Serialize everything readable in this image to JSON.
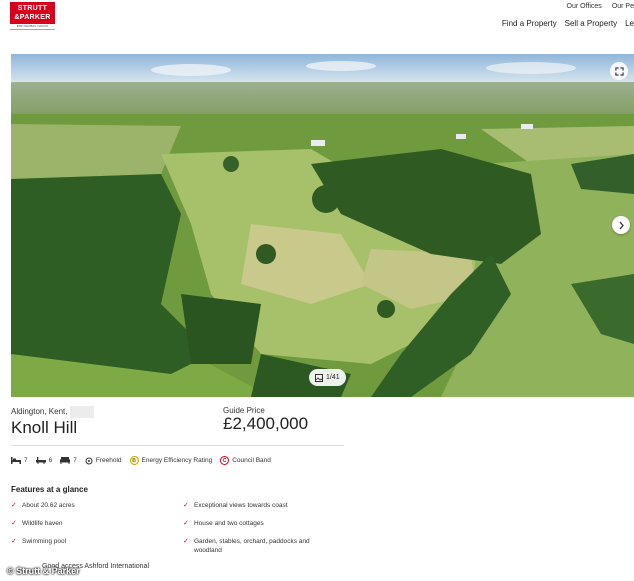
{
  "brand": {
    "line1": "STRUTT",
    "line2": "&PARKER",
    "tagline": "BNP PARIBAS GROUP"
  },
  "top_links": [
    "Our Offices",
    "Our Pe"
  ],
  "nav": [
    "Find a Property",
    "Sell a Property",
    "Le"
  ],
  "gallery": {
    "counter": "1/41"
  },
  "listing": {
    "location": "Aldington, Kent,",
    "title": "Knoll Hill",
    "price_label": "Guide Price",
    "price": "£2,400,000"
  },
  "specs": {
    "bedrooms": "7",
    "bathrooms": "6",
    "receptions": "7",
    "tenure": "Freehold",
    "epc_letter": "B",
    "epc_label": "Energy Efficiency Rating",
    "tax_letter": "C",
    "tax_label": "Council Band"
  },
  "features": {
    "heading": "Features at a glance",
    "left": [
      "About 20.62 acres",
      "Wildlife haven",
      "Swimming pool"
    ],
    "right": [
      "Exceptional views towards coast",
      "House and two cottages",
      "Garden, stables, orchard, paddocks and woodland"
    ]
  },
  "partial_text": "Good access    Ashford International",
  "caption": "© Strutt & Parker",
  "colors": {
    "brand_red": "#d6001c"
  }
}
